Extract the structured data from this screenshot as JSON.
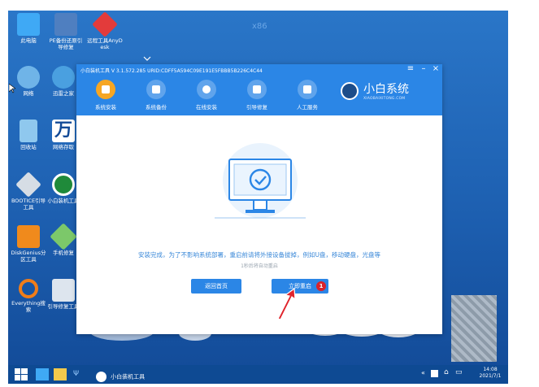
{
  "desktop": {
    "watermark": "x86",
    "icons": [
      {
        "label": "此电脑",
        "color": "#3fa9f5"
      },
      {
        "label": "PE备份还原引导修复",
        "color": "#4f7fc0"
      },
      {
        "label": "远程工具AnyDesk",
        "color": "#e33b3b"
      },
      {
        "label": "网络",
        "color": "#6fb4e8"
      },
      {
        "label": "迅雷之家",
        "color": "#4aa0e0"
      },
      {
        "label": "回收站",
        "color": "#8fc8ee"
      },
      {
        "label": "网络存取",
        "color": "#ffffff"
      },
      {
        "label": "BOOTICE引导工具",
        "color": "#d6dde5"
      },
      {
        "label": "小白装机工具",
        "color": "#1f8a3a"
      },
      {
        "label": "DiskGenius分区工具",
        "color": "#f08a1c"
      },
      {
        "label": "手机修复",
        "color": "#7cc86a"
      },
      {
        "label": "Everything搜索",
        "color": "#f07d1a"
      },
      {
        "label": "引导修复工具",
        "color": "#dde5ee"
      }
    ]
  },
  "window": {
    "title": "小白装机工具 V 3.1.572.285 URID:CDFF5A594C09E191E5FBBB5B226C4C44",
    "controls": {
      "menu": "≡",
      "minimize": "–",
      "close": "×"
    },
    "tabs": [
      {
        "label": "系统安装",
        "icon": "system-install-icon",
        "active": true
      },
      {
        "label": "系统备份",
        "icon": "backup-icon",
        "active": false
      },
      {
        "label": "在线安装",
        "icon": "download-icon",
        "active": false
      },
      {
        "label": "引导修复",
        "icon": "toolbox-icon",
        "active": false
      },
      {
        "label": "人工服务",
        "icon": "chat-icon",
        "active": false
      }
    ],
    "brand": {
      "name": "小白系统",
      "url": "XIAOBAIXITONG.COM"
    },
    "message": "安装完成，为了不影响系统部署，重启前请将外接设备拔掉，例如U盘，移动硬盘，光盘等",
    "countdown": "1秒后将自动重启",
    "buttons": {
      "back": "返回首页",
      "restart": "立即重启"
    },
    "badge": "1"
  },
  "taskbar": {
    "app_label": "小白装机工具",
    "time": "14:08",
    "date": "2021/7/1"
  },
  "colors": {
    "accent": "#2b86e6",
    "active_tab": "#f6a623",
    "badge": "#d9232b"
  }
}
